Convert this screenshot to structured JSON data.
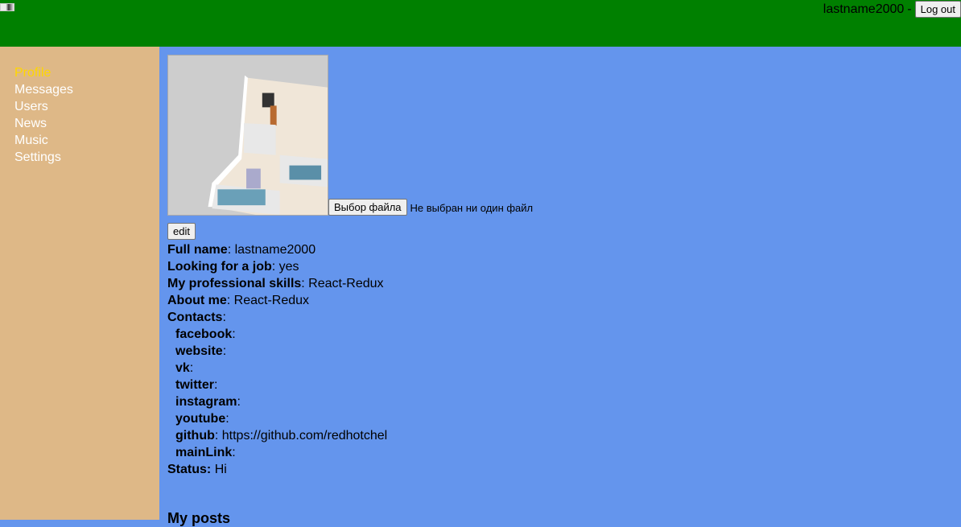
{
  "header": {
    "username": "lastname2000",
    "separator": "-",
    "logout_label": "Log out"
  },
  "sidebar": {
    "items": [
      {
        "label": "Profile",
        "active": true
      },
      {
        "label": "Messages"
      },
      {
        "label": "Users"
      },
      {
        "label": "News"
      },
      {
        "label": "Music"
      },
      {
        "label": "Settings"
      }
    ]
  },
  "profile": {
    "file_button": "Выбор файла",
    "file_status": "Не выбран ни один файл",
    "edit_label": "edit",
    "full_name_label": "Full name",
    "full_name": "lastname2000",
    "job_label": "Looking for a job",
    "job": "yes",
    "skills_label": "My professional skills",
    "skills": "React-Redux",
    "about_label": "About me",
    "about": "React-Redux",
    "contacts_label": "Contacts",
    "contacts": [
      {
        "k": "facebook",
        "v": ""
      },
      {
        "k": "website",
        "v": ""
      },
      {
        "k": "vk",
        "v": ""
      },
      {
        "k": "twitter",
        "v": ""
      },
      {
        "k": "instagram",
        "v": ""
      },
      {
        "k": "youtube",
        "v": ""
      },
      {
        "k": "github",
        "v": "https://github.com/redhotchel"
      },
      {
        "k": "mainLink",
        "v": ""
      }
    ],
    "status_label": "Status:",
    "status": "Hi"
  },
  "posts": {
    "title": "My posts"
  },
  "colors": {
    "header": "#008000",
    "sidebar": "#deb887",
    "main": "#6495ed",
    "active_nav": "#ffd700"
  }
}
